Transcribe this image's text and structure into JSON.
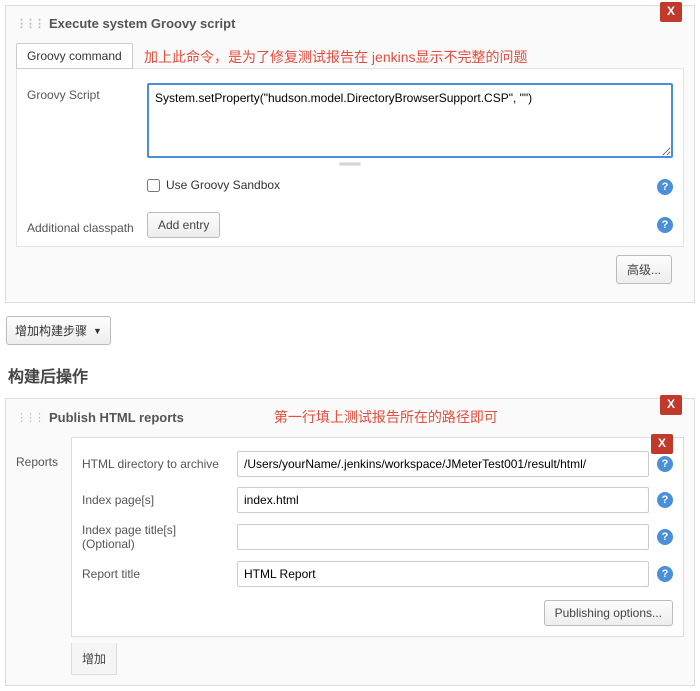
{
  "groovySection": {
    "title": "Execute system Groovy script",
    "closeLabel": "X",
    "tab": "Groovy command",
    "annotation": "加上此命令，是为了修复测试报告在 jenkins显示不完整的问题",
    "scriptLabel": "Groovy Script",
    "scriptValue": "System.setProperty(\"hudson.model.DirectoryBrowserSupport.CSP\", \"\")",
    "sandboxLabel": "Use Groovy Sandbox",
    "classpathLabel": "Additional classpath",
    "addEntryBtn": "Add entry",
    "advancedBtn": "高级..."
  },
  "addStepBtn": "增加构建步骤",
  "postBuildHeading": "构建后操作",
  "publishSection": {
    "title": "Publish HTML reports",
    "closeLabel": "X",
    "annotation": "第一行填上测试报告所在的路径即可",
    "reportsLabel": "Reports",
    "innerCloseLabel": "X",
    "rows": {
      "dirLabel": "HTML directory to archive",
      "dirValue": "/Users/yourName/.jenkins/workspace/JMeterTest001/result/html/",
      "indexLabel": "Index page[s]",
      "indexValue": "index.html",
      "titlesLabel": "Index page title[s] (Optional)",
      "titlesValue": "",
      "reportTitleLabel": "Report title",
      "reportTitleValue": "HTML Report"
    },
    "publishingOptionsBtn": "Publishing options...",
    "addBtn": "增加"
  },
  "helpIcon": "?"
}
